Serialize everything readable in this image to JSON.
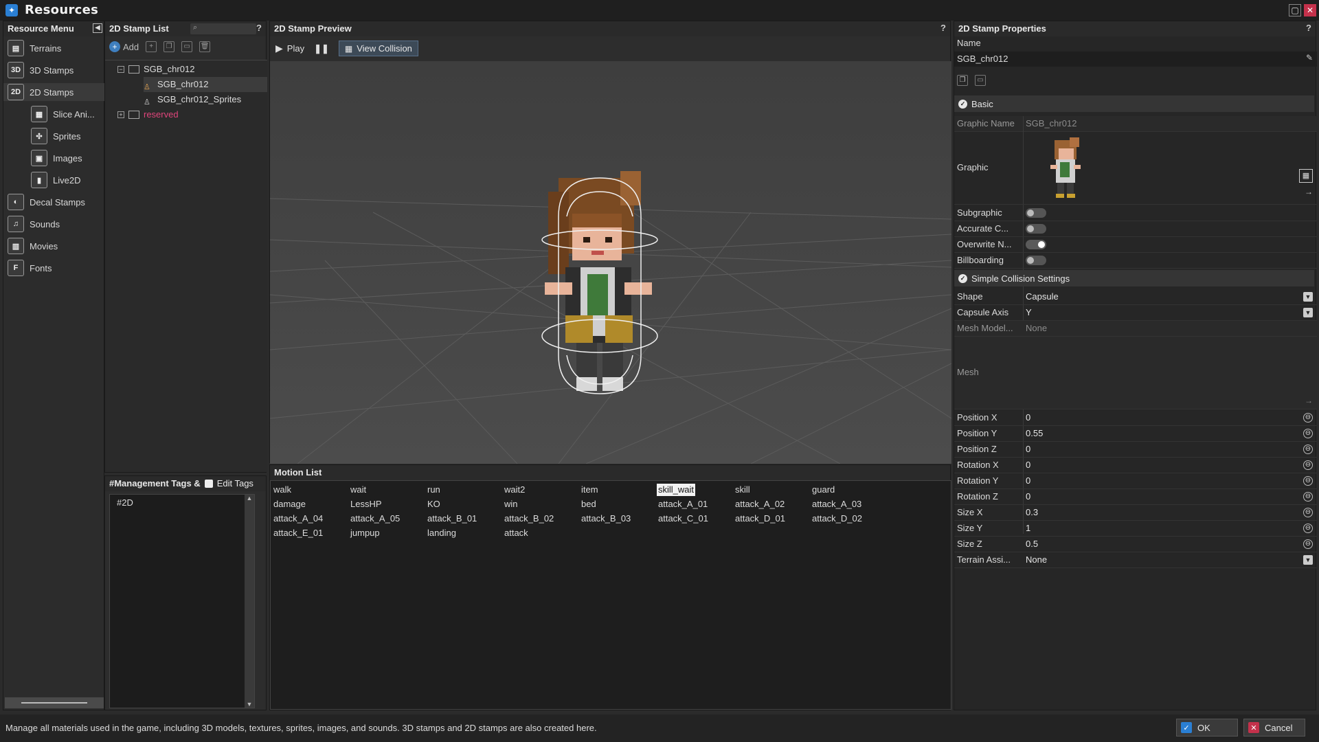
{
  "window": {
    "title": "Resources",
    "maximize_icon": "maximize-icon",
    "close_icon": "close-icon"
  },
  "resource_menu": {
    "title": "Resource Menu",
    "items": [
      {
        "label": "Terrains",
        "icon": "terrain-icon"
      },
      {
        "label": "3D Stamps",
        "icon": "3d-icon"
      },
      {
        "label": "2D Stamps",
        "icon": "2d-icon"
      },
      {
        "label": "Slice Ani...",
        "icon": "slice-icon"
      },
      {
        "label": "Sprites",
        "icon": "sprites-icon"
      },
      {
        "label": "Images",
        "icon": "images-icon"
      },
      {
        "label": "Live2D",
        "icon": "live2d-icon"
      },
      {
        "label": "Decal Stamps",
        "icon": "decal-icon"
      },
      {
        "label": "Sounds",
        "icon": "sounds-icon"
      },
      {
        "label": "Movies",
        "icon": "movies-icon"
      },
      {
        "label": "Fonts",
        "icon": "fonts-icon"
      }
    ]
  },
  "stamp_list": {
    "title": "2D Stamp List",
    "help": "?",
    "add_label": "Add",
    "tree": [
      {
        "label": "SGB_chr012"
      },
      {
        "label": "SGB_chr012"
      },
      {
        "label": "SGB_chr012_Sprites"
      },
      {
        "label": "reserved"
      }
    ]
  },
  "tags": {
    "title": "#Management Tags &",
    "edit_label": "Edit Tags",
    "values": [
      "#2D"
    ]
  },
  "preview": {
    "title": "2D Stamp Preview",
    "help": "?",
    "play_label": "Play",
    "view_collision_label": "View Collision"
  },
  "motion_list": {
    "title": "Motion List",
    "rows": [
      [
        "walk",
        "wait",
        "run",
        "wait2",
        "item",
        "skill_wait",
        "skill",
        "guard"
      ],
      [
        "damage",
        "LessHP",
        "KO",
        "win",
        "bed",
        "attack_A_01",
        "attack_A_02",
        "attack_A_03"
      ],
      [
        "attack_A_04",
        "attack_A_05",
        "attack_B_01",
        "attack_B_02",
        "attack_B_03",
        "attack_C_01",
        "attack_D_01",
        "attack_D_02"
      ],
      [
        "attack_E_01",
        "jumpup",
        "landing",
        "attack"
      ]
    ],
    "selected": "skill_wait"
  },
  "properties": {
    "title": "2D Stamp Properties",
    "help": "?",
    "name_label": "Name",
    "name_value": "SGB_chr012",
    "basic_section": "Basic",
    "graphic_name_label": "Graphic Name",
    "graphic_name_value": "SGB_chr012",
    "graphic_label": "Graphic",
    "subgraphic_label": "Subgraphic",
    "accurate_label": "Accurate C...",
    "overwrite_label": "Overwrite N...",
    "billboarding_label": "Billboarding",
    "collision_section": "Simple Collision Settings",
    "shape_label": "Shape",
    "shape_value": "Capsule",
    "capsule_axis_label": "Capsule Axis",
    "capsule_axis_value": "Y",
    "mesh_model_label": "Mesh Model...",
    "mesh_model_value": "None",
    "mesh_label": "Mesh",
    "transform": [
      {
        "label": "Position X",
        "value": "0"
      },
      {
        "label": "Position Y",
        "value": "0.55"
      },
      {
        "label": "Position Z",
        "value": "0"
      },
      {
        "label": "Rotation X",
        "value": "0"
      },
      {
        "label": "Rotation Y",
        "value": "0"
      },
      {
        "label": "Rotation Z",
        "value": "0"
      },
      {
        "label": "Size X",
        "value": "0.3"
      },
      {
        "label": "Size Y",
        "value": "1"
      },
      {
        "label": "Size Z",
        "value": "0.5"
      }
    ],
    "terrain_label": "Terrain Assi...",
    "terrain_value": "None"
  },
  "status": {
    "message": "Manage all materials used in the game, including 3D models, textures, sprites, images, and sounds. 3D stamps and 2D stamps are also created here.",
    "ok_label": "OK",
    "cancel_label": "Cancel"
  },
  "colors": {
    "accent": "#2a7fd4",
    "reserved": "#e0457b",
    "close": "#c4314b"
  }
}
